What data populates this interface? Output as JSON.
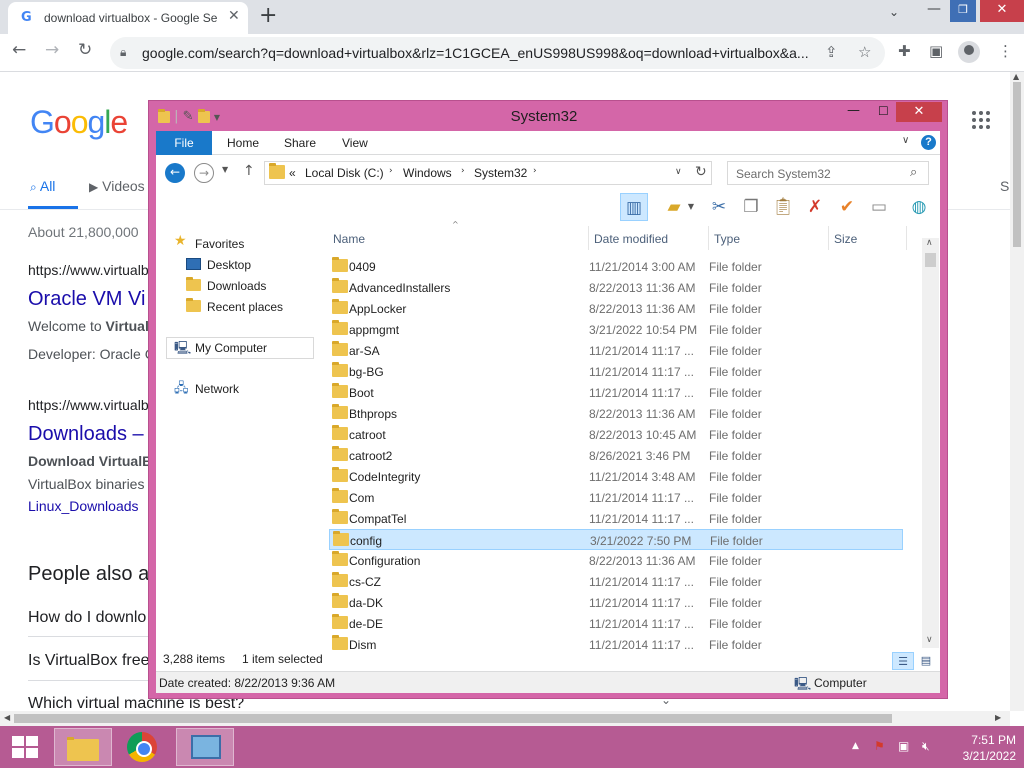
{
  "browser": {
    "tab_title": "download virtualbox - Google Se",
    "url": "google.com/search?q=download+virtualbox&rlz=1C1GCEA_enUS998US998&oq=download+virtualbox&a..."
  },
  "google": {
    "logo": "Google",
    "tabs": [
      "All",
      "Videos"
    ],
    "right_tab_partial": "S",
    "about": "About 21,800,000",
    "results": [
      {
        "cite": "https://www.virtualb",
        "title": "Oracle VM Vi",
        "line1_prefix": "Welcome to ",
        "line1_bold": "Virtual",
        "line2": "Developer: Oracle C"
      },
      {
        "cite": "https://www.virtualb",
        "title": "Downloads –",
        "line1_bold": "Download VirtualBo",
        "line2": "VirtualBox binaries",
        "link": "Linux_Downloads"
      }
    ],
    "people_also_ask": "People also a",
    "questions": [
      "How do I downlo",
      "Is VirtualBox free",
      "Which virtual machine is best?"
    ]
  },
  "explorer": {
    "title": "System32",
    "ribbon_tabs": [
      "File",
      "Home",
      "Share",
      "View"
    ],
    "breadcrumb": [
      "Local Disk (C:)",
      "Windows",
      "System32"
    ],
    "breadcrumb_prefix": "«",
    "search_placeholder": "Search System32",
    "nav": {
      "favorites": "Favorites",
      "desktop": "Desktop",
      "downloads": "Downloads",
      "recent": "Recent places",
      "computer": "My Computer",
      "network": "Network"
    },
    "columns": {
      "name": "Name",
      "date": "Date modified",
      "type": "Type",
      "size": "Size"
    },
    "files": [
      {
        "name": "0409",
        "date": "11/21/2014 3:00 AM",
        "type": "File folder"
      },
      {
        "name": "AdvancedInstallers",
        "date": "8/22/2013 11:36 AM",
        "type": "File folder"
      },
      {
        "name": "AppLocker",
        "date": "8/22/2013 11:36 AM",
        "type": "File folder"
      },
      {
        "name": "appmgmt",
        "date": "3/21/2022 10:54 PM",
        "type": "File folder"
      },
      {
        "name": "ar-SA",
        "date": "11/21/2014 11:17 ...",
        "type": "File folder"
      },
      {
        "name": "bg-BG",
        "date": "11/21/2014 11:17 ...",
        "type": "File folder"
      },
      {
        "name": "Boot",
        "date": "11/21/2014 11:17 ...",
        "type": "File folder"
      },
      {
        "name": "Bthprops",
        "date": "8/22/2013 11:36 AM",
        "type": "File folder"
      },
      {
        "name": "catroot",
        "date": "8/22/2013 10:45 AM",
        "type": "File folder"
      },
      {
        "name": "catroot2",
        "date": "8/26/2021 3:46 PM",
        "type": "File folder"
      },
      {
        "name": "CodeIntegrity",
        "date": "11/21/2014 3:48 AM",
        "type": "File folder"
      },
      {
        "name": "Com",
        "date": "11/21/2014 11:17 ...",
        "type": "File folder"
      },
      {
        "name": "CompatTel",
        "date": "11/21/2014 11:17 ...",
        "type": "File folder"
      },
      {
        "name": "config",
        "date": "3/21/2022 7:50 PM",
        "type": "File folder"
      },
      {
        "name": "Configuration",
        "date": "8/22/2013 11:36 AM",
        "type": "File folder"
      },
      {
        "name": "cs-CZ",
        "date": "11/21/2014 11:17 ...",
        "type": "File folder"
      },
      {
        "name": "da-DK",
        "date": "11/21/2014 11:17 ...",
        "type": "File folder"
      },
      {
        "name": "de-DE",
        "date": "11/21/2014 11:17 ...",
        "type": "File folder"
      },
      {
        "name": "Dism",
        "date": "11/21/2014 11:17 ...",
        "type": "File folder"
      }
    ],
    "selected_index": 13,
    "status": {
      "count": "3,288 items",
      "selected": "1 item selected"
    },
    "details": {
      "created": "Date created: 8/22/2013 9:36 AM",
      "location": "Computer"
    }
  },
  "taskbar": {
    "time": "7:51 PM",
    "date": "3/21/2022"
  },
  "colors": {
    "window_frame": "#d466a8",
    "taskbar": "#b65b93",
    "accent_blue": "#1979ca",
    "selection": "#cce8ff",
    "close_red": "#c7404b"
  }
}
